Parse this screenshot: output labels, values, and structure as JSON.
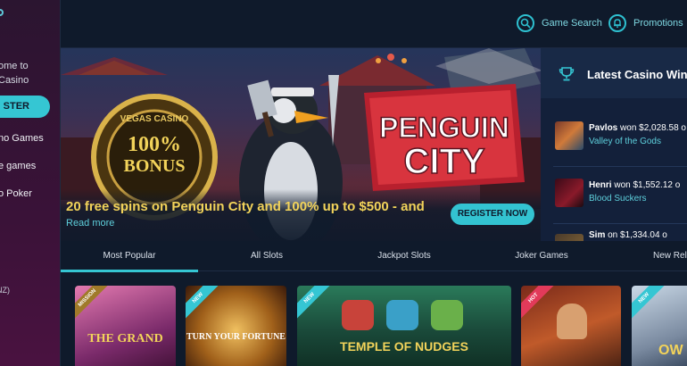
{
  "sidebar": {
    "welcome_line1": "ome to",
    "welcome_line2": "Casino",
    "register_label": "STER",
    "nav": [
      "no Games",
      "e games",
      "o Poker"
    ],
    "currency": "NZ)"
  },
  "topbar": {
    "game_search": "Game Search",
    "promotions": "Promotions"
  },
  "hero": {
    "logo_casino": "VEGAS CASINO",
    "bonus_pct": "100%",
    "bonus_word": "BONUS",
    "game_title_1": "PENGUIN",
    "game_title_2": "CITY",
    "headline": "20 free spins on Penguin City and 100% up to $500 - and",
    "read_more": "Read more",
    "cta": "REGISTER NOW"
  },
  "winners": {
    "title": "Latest Casino Win",
    "items": [
      {
        "name": "Pavlos",
        "text": "won $2,028.58 o",
        "game": "Valley of the Gods"
      },
      {
        "name": "Henri",
        "text": "won $1,552.12 o",
        "game": "Blood Suckers"
      },
      {
        "name": "Sim",
        "text": "on $1,334.04 o",
        "game": ""
      }
    ]
  },
  "tabs": [
    "Most Popular",
    "All Slots",
    "Jackpot Slots",
    "Joker Games",
    "New Rele"
  ],
  "games": [
    {
      "badge": "MISSION",
      "title": "THE GRAND",
      "badge_color": "#a07a2a"
    },
    {
      "badge": "NEW",
      "title": "TURN YOUR FORTUNE",
      "badge_color": "#35c6d3"
    },
    {
      "badge": "NEW",
      "title": "TEMPLE OF NUDGES",
      "badge_color": "#35c6d3"
    },
    {
      "badge": "HOT",
      "title": "",
      "badge_color": "#e23a5a"
    },
    {
      "badge": "NEW",
      "title": "OW",
      "badge_color": "#35c6d3"
    }
  ],
  "colors": {
    "accent": "#35c6d3",
    "gold": "#f2d35a",
    "bg": "#0f1a2b"
  }
}
